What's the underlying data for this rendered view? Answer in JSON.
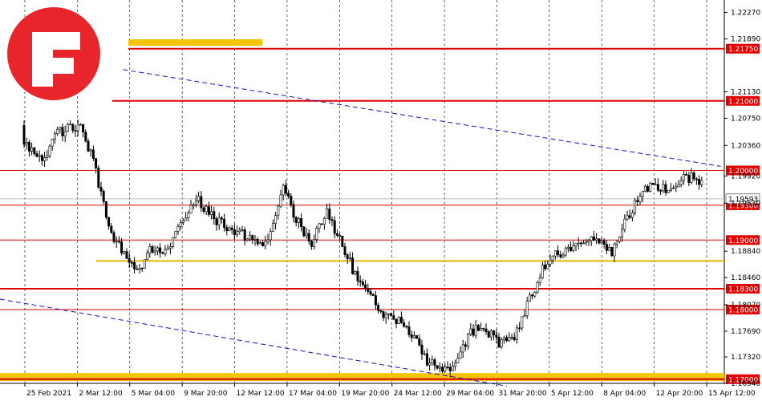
{
  "chart_data": {
    "type": "candlestick",
    "symbol": "EURUSD H4",
    "y_ticks": [
      "1.22270",
      "1.21890",
      "1.21130",
      "1.20750",
      "1.20360",
      "1.19920",
      "1.19530",
      "1.18840",
      "1.18460",
      "1.18070",
      "1.17690",
      "1.17320",
      "1.16940"
    ],
    "x_ticks": [
      "25 Feb 2021",
      "2 Mar 12:00",
      "5 Mar 04:00",
      "9 Mar 20:00",
      "12 Mar 12:00",
      "17 Mar 04:00",
      "19 Mar 20:00",
      "24 Mar 12:00",
      "29 Mar 04:00",
      "31 Mar 20:00",
      "5 Apr 12:00",
      "8 Apr 04:00",
      "12 Apr 20:00",
      "15 Apr 12:00"
    ],
    "ylim": [
      1.1694,
      1.2245
    ],
    "levels": [
      {
        "label": "1.21750",
        "value": 1.2175,
        "color": "#e00000"
      },
      {
        "label": "1.21000",
        "value": 1.21,
        "color": "#e00000"
      },
      {
        "label": "1.20000",
        "value": 1.2,
        "color": "#e00000"
      },
      {
        "label": "1.19500",
        "value": 1.195,
        "color": "#e00000"
      },
      {
        "label": "1.19000",
        "value": 1.19,
        "color": "#e00000"
      },
      {
        "label": "1.18300",
        "value": 1.183,
        "color": "#e00000"
      },
      {
        "label": "1.18000",
        "value": 1.18,
        "color": "#e00000"
      },
      {
        "label": "1.17000",
        "value": 1.17,
        "color": "#e00000"
      }
    ],
    "current_price": {
      "label": "1.19593",
      "value": 1.19593
    },
    "support_zones": [
      {
        "value": 1.187,
        "color": "#e8b800"
      },
      {
        "value": 1.1703,
        "color": "#f5c400"
      }
    ],
    "trend_lines": [
      {
        "from": {
          "x": 0.17,
          "y": 1.2145
        },
        "to": {
          "x": 0.995,
          "y": 1.2006
        }
      },
      {
        "from": {
          "x": 0.0,
          "y": 1.1815
        },
        "to": {
          "x": 0.7,
          "y": 1.169
        }
      }
    ],
    "price_path": [
      [
        0.0,
        1.2065
      ],
      [
        0.03,
        1.204
      ],
      [
        0.06,
        1.202
      ],
      [
        0.08,
        1.2055
      ],
      [
        0.11,
        1.2065
      ],
      [
        0.13,
        1.201
      ],
      [
        0.15,
        1.192
      ],
      [
        0.17,
        1.188
      ],
      [
        0.19,
        1.185
      ],
      [
        0.21,
        1.189
      ],
      [
        0.23,
        1.188
      ],
      [
        0.25,
        1.193
      ],
      [
        0.27,
        1.196
      ],
      [
        0.29,
        1.1935
      ],
      [
        0.31,
        1.192
      ],
      [
        0.33,
        1.191
      ],
      [
        0.35,
        1.1895
      ],
      [
        0.37,
        1.19
      ],
      [
        0.39,
        1.1975
      ],
      [
        0.41,
        1.193
      ],
      [
        0.43,
        1.1895
      ],
      [
        0.45,
        1.194
      ],
      [
        0.47,
        1.19
      ],
      [
        0.49,
        1.185
      ],
      [
        0.51,
        1.1825
      ],
      [
        0.53,
        1.179
      ],
      [
        0.55,
        1.1785
      ],
      [
        0.57,
        1.176
      ],
      [
        0.59,
        1.1725
      ],
      [
        0.61,
        1.171
      ],
      [
        0.63,
        1.1725
      ],
      [
        0.65,
        1.177
      ],
      [
        0.67,
        1.177
      ],
      [
        0.69,
        1.175
      ],
      [
        0.71,
        1.176
      ],
      [
        0.73,
        1.181
      ],
      [
        0.75,
        1.186
      ],
      [
        0.77,
        1.188
      ],
      [
        0.79,
        1.189
      ],
      [
        0.81,
        1.1905
      ],
      [
        0.83,
        1.19
      ],
      [
        0.845,
        1.188
      ],
      [
        0.86,
        1.192
      ],
      [
        0.88,
        1.196
      ],
      [
        0.9,
        1.198
      ],
      [
        0.92,
        1.197
      ],
      [
        0.94,
        1.1985
      ],
      [
        0.96,
        1.1993
      ],
      [
        0.985,
        1.19593
      ]
    ]
  }
}
